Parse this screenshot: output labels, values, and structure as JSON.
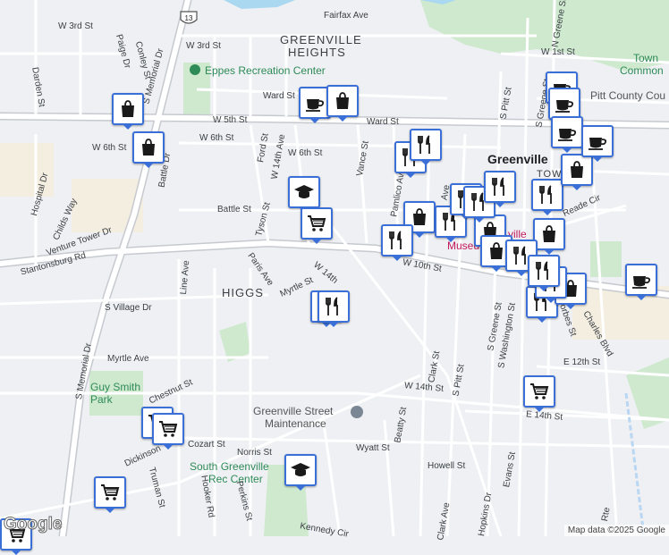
{
  "map": {
    "attribution": "Map data ©2025 Google",
    "logo": "Google",
    "route_shield": "13",
    "colors": {
      "marker_border": "#3b6fd8",
      "marker_icon": "#1a1a1a",
      "park": "#cde8c9",
      "water": "#a9d8f0",
      "road": "#ffffff",
      "highway": "#c6c9cf"
    }
  },
  "areas": [
    {
      "text": "GREENVILLE",
      "cls": "area"
    },
    {
      "text": "HEIGHTS",
      "cls": "area"
    },
    {
      "text": "HIGGS",
      "cls": "area"
    },
    {
      "text": "Greenville",
      "cls": "big"
    },
    {
      "text": "TOWN",
      "cls": "area"
    }
  ],
  "places": [
    {
      "text": "Eppes Recreation Center",
      "cls": "poi"
    },
    {
      "text": "Guy Smith",
      "cls": "park"
    },
    {
      "text": "Park",
      "cls": "park"
    },
    {
      "text": "Greenville Street",
      "cls": "grey"
    },
    {
      "text": "Maintenance",
      "cls": "grey"
    },
    {
      "text": "South Greenville",
      "cls": "poi"
    },
    {
      "text": "Rec Center",
      "cls": "poi"
    },
    {
      "text": "Museu",
      "cls": "museum"
    },
    {
      "text": "ville",
      "cls": "museum"
    },
    {
      "text": "Town",
      "cls": "park"
    },
    {
      "text": "Common",
      "cls": "park"
    },
    {
      "text": "Pitt County Cou",
      "cls": "grey"
    }
  ],
  "streets": [
    "W 3rd St",
    "Fairfax Ave",
    "W 3rd St",
    "Paige Dr",
    "Conley St",
    "S Memorial Dr",
    "Darden St",
    "Ward St",
    "Ward St",
    "W 5th St",
    "W 6th St",
    "W 6th St",
    "W 6th St",
    "Ford St",
    "W 14th Ave",
    "Vance St",
    "Battle Dr",
    "Hospital Dr",
    "Childs Way",
    "Venture Tower Dr",
    "Stantonsburg Rd",
    "Battle St",
    "Tyson St",
    "Pamlico Ave",
    "Line Ave",
    "Paris Ave",
    "Myrtle St",
    "W 14th",
    "W 10th St",
    "S Village Dr",
    "Myrtle Ave",
    "Chestnut St",
    "Clark St",
    "S Pitt St",
    "S Greene St",
    "S Washington St",
    "Forbes St",
    "Charles Blvd",
    "E 12th St",
    "W 14th St",
    "E 14th St",
    "Beatty St",
    "Dickinson",
    "Cozart St",
    "Norris St",
    "Wyatt St",
    "Howell St",
    "Truman St",
    "Hooker Rd",
    "Perkins St",
    "Evans St",
    "S Memorial Dr",
    "W 1st St",
    "S Pitt St",
    "S Greene St",
    "N Greene St",
    "Reade Cir",
    "Kennedy Cir",
    "Hopkins Dr",
    "Clark Ave",
    "Ave",
    "Rte"
  ],
  "markers": [
    {
      "type": "grocery"
    },
    {
      "type": "grocery"
    },
    {
      "type": "shopping"
    },
    {
      "type": "coffee"
    },
    {
      "type": "shopping"
    },
    {
      "type": "shopping"
    },
    {
      "type": "school"
    },
    {
      "type": "grocery"
    },
    {
      "type": "restaurant"
    },
    {
      "type": "restaurant"
    },
    {
      "type": "restaurant"
    },
    {
      "type": "restaurant"
    },
    {
      "type": "shopping"
    },
    {
      "type": "restaurant"
    },
    {
      "type": "restaurant"
    },
    {
      "type": "restaurant"
    },
    {
      "type": "shopping"
    },
    {
      "type": "restaurant"
    },
    {
      "type": "shopping"
    },
    {
      "type": "shopping"
    },
    {
      "type": "restaurant"
    },
    {
      "type": "restaurant"
    },
    {
      "type": "restaurant"
    },
    {
      "type": "shopping"
    },
    {
      "type": "restaurant"
    },
    {
      "type": "shopping"
    },
    {
      "type": "coffee"
    },
    {
      "type": "coffee"
    },
    {
      "type": "coffee"
    },
    {
      "type": "coffee"
    },
    {
      "type": "grocery"
    },
    {
      "type": "school"
    },
    {
      "type": "grocery"
    },
    {
      "type": "grocery"
    },
    {
      "type": "restaurant"
    },
    {
      "type": "restaurant"
    },
    {
      "type": "coffee"
    }
  ]
}
